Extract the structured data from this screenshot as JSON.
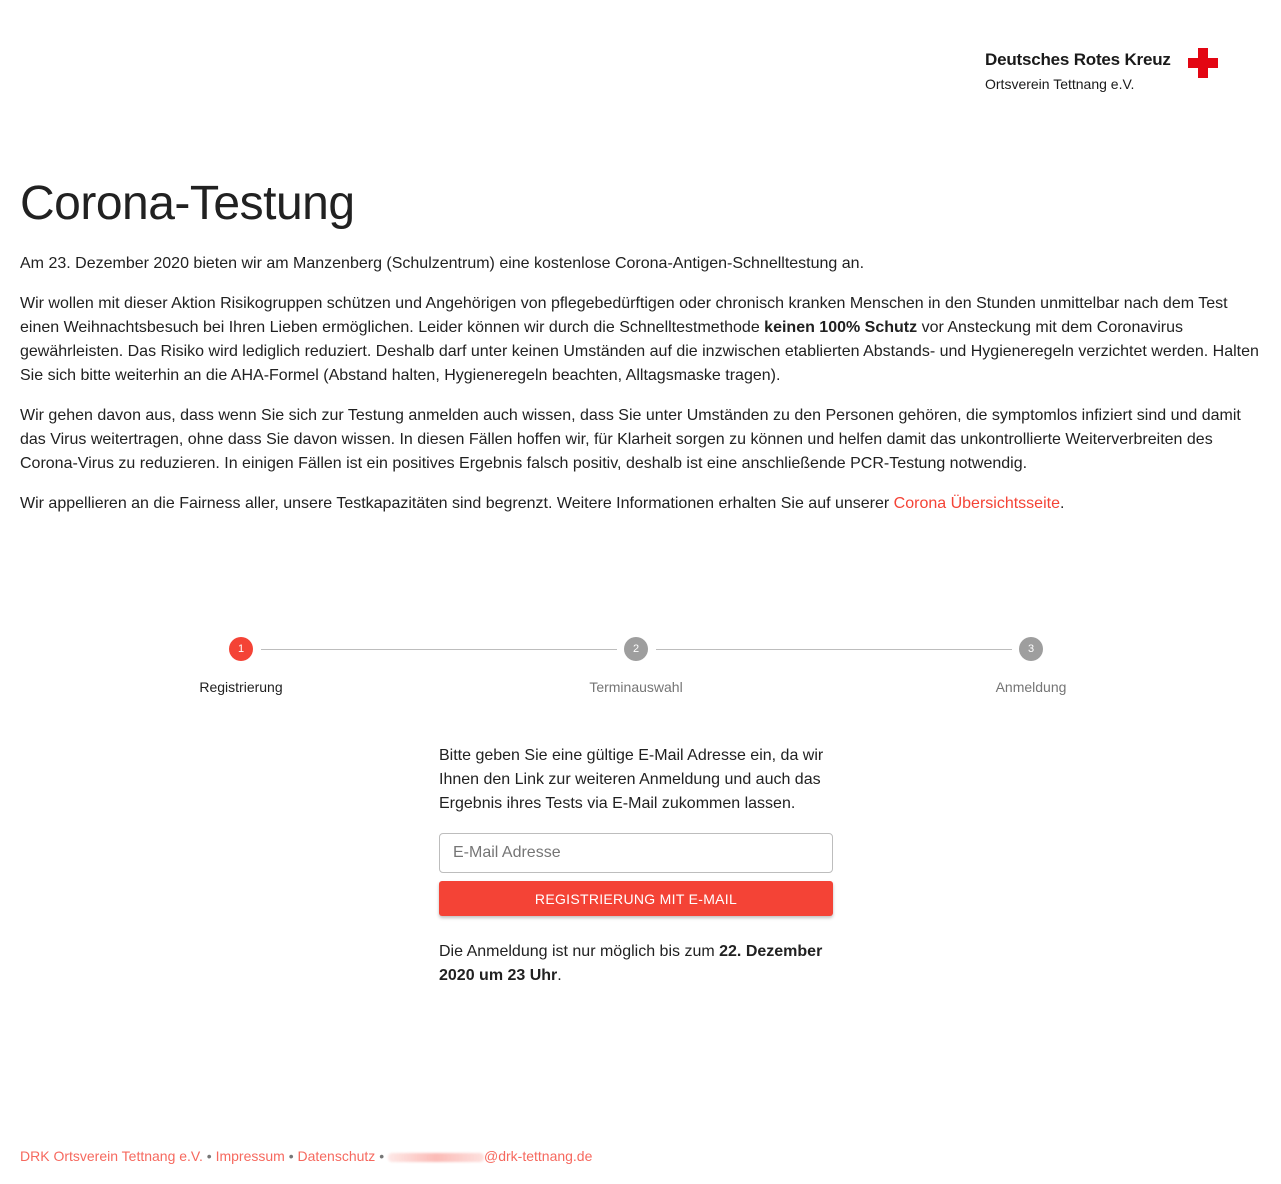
{
  "logo": {
    "name": "Deutsches Rotes Kreuz",
    "subtitle": "Ortsverein Tettnang e.V.",
    "color": "#e30613"
  },
  "page": {
    "title": "Corona-Testung"
  },
  "intro": {
    "p1": "Am 23. Dezember 2020 bieten wir am Manzenberg (Schulzentrum) eine kostenlose Corona-Antigen-Schnelltestung an.",
    "p2_before": "Wir wollen mit dieser Aktion Risikogruppen schützen und Angehörigen von pflegebedürftigen oder chronisch kranken Menschen in den Stunden unmittelbar nach dem Test einen Weihnachtsbesuch bei Ihren Lieben ermöglichen. Leider können wir durch die Schnelltestmethode ",
    "p2_bold": "keinen 100% Schutz",
    "p2_after": " vor Ansteckung mit dem Coronavirus gewährleisten. Das Risiko wird lediglich reduziert. Deshalb darf unter keinen Umständen auf die inzwischen etablierten Abstands- und Hygieneregeln verzichtet werden. Halten Sie sich bitte weiterhin an die AHA-Formel (Abstand halten, Hygieneregeln beachten, Alltagsmaske tragen).",
    "p3": "Wir gehen davon aus, dass wenn Sie sich zur Testung anmelden auch wissen, dass Sie unter Umständen zu den Personen gehören, die symptomlos infiziert sind und damit das Virus weitertragen, ohne dass Sie davon wissen. In diesen Fällen hoffen wir, für Klarheit sorgen zu können und helfen damit das unkontrollierte Weiterverbreiten des Corona-Virus zu reduzieren. In einigen Fällen ist ein positives Ergebnis falsch positiv, deshalb ist eine anschließende PCR-Testung notwendig.",
    "p4_before": "Wir appellieren an die Fairness aller, unsere Testkapazitäten sind begrenzt. Weitere Informationen erhalten Sie auf unserer ",
    "p4_link": "Corona Übersichtsseite",
    "p4_after": "."
  },
  "stepper": {
    "steps": [
      {
        "number": "1",
        "label": "Registrierung",
        "active": true
      },
      {
        "number": "2",
        "label": "Terminauswahl",
        "active": false
      },
      {
        "number": "3",
        "label": "Anmeldung",
        "active": false
      }
    ],
    "active_color": "#f44336",
    "inactive_color": "#9e9e9e"
  },
  "form": {
    "text": "Bitte geben Sie eine gültige E-Mail Adresse ein, da wir Ihnen den Link zur weiteren Anmeldung und auch das Ergebnis ihres Tests via E-Mail zukommen lassen.",
    "email_placeholder": "E-Mail Adresse",
    "email_value": "",
    "button_label": "REGISTRIERUNG MIT E-MAIL",
    "button_color": "#f44336",
    "deadline_before": "Die Anmeldung ist nur möglich bis zum ",
    "deadline_bold": "22. Dezember 2020 um 23 Uhr",
    "deadline_after": "."
  },
  "footer": {
    "org": "DRK Ortsverein Tettnang e.V.",
    "separator": "•",
    "impressum": "Impressum",
    "datenschutz": "Datenschutz",
    "email_domain": "@drk-tettnang.de"
  }
}
